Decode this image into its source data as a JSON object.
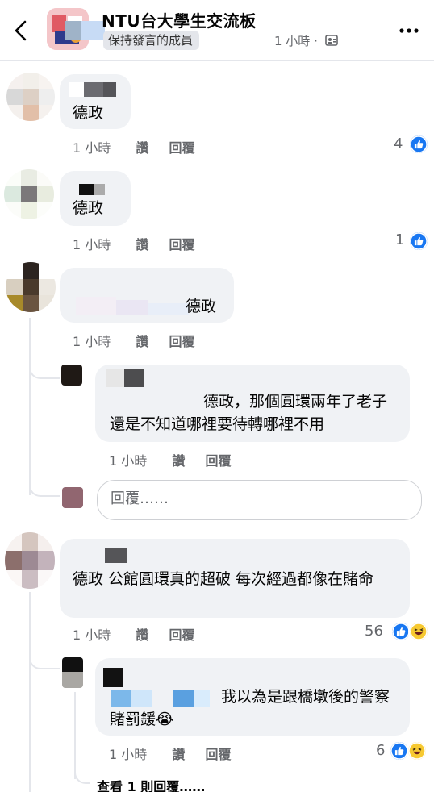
{
  "header": {
    "group_name": "NTU台大學生交流板",
    "member_badge": "保持發言的成員",
    "post_time": "1 小時 ·",
    "audience_icon": "group-audience-icon",
    "more_icon": "more-options-icon",
    "back_icon": "back-chevron-icon"
  },
  "comments": [
    {
      "text": "德政",
      "time": "1 小時",
      "like_label": "讚",
      "reply_label": "回覆",
      "reactions": "4"
    },
    {
      "text": "德政",
      "time": "1 小時",
      "like_label": "讚",
      "reply_label": "回覆",
      "reactions": "1"
    },
    {
      "text": "德政",
      "time": "1 小時",
      "like_label": "讚",
      "reply_label": "回覆",
      "reactions": "",
      "reply": {
        "text": "德政，那個圓環兩年了老子還是不知道哪裡要待轉哪裡不用",
        "time": "1 小時",
        "like_label": "讚",
        "reply_label": "回覆"
      },
      "reply_placeholder": "回覆……"
    },
    {
      "text": "德政 公館圓環真的超破 每次經過都像在賭命",
      "time": "1 小時",
      "like_label": "讚",
      "reply_label": "回覆",
      "reactions": "56",
      "reply": {
        "text": "我以為是跟橋墩後的警察賭罰鍰😭",
        "time": "1 小時",
        "like_label": "讚",
        "reply_label": "回覆",
        "reactions": "6"
      },
      "view_replies": "查看 1 則回覆……"
    }
  ],
  "colors": {
    "like_blue": "#1877f2",
    "haha_yellow": "#f7c930",
    "bubble_gray": "#f0f2f5",
    "meta_gray": "#65676b"
  }
}
